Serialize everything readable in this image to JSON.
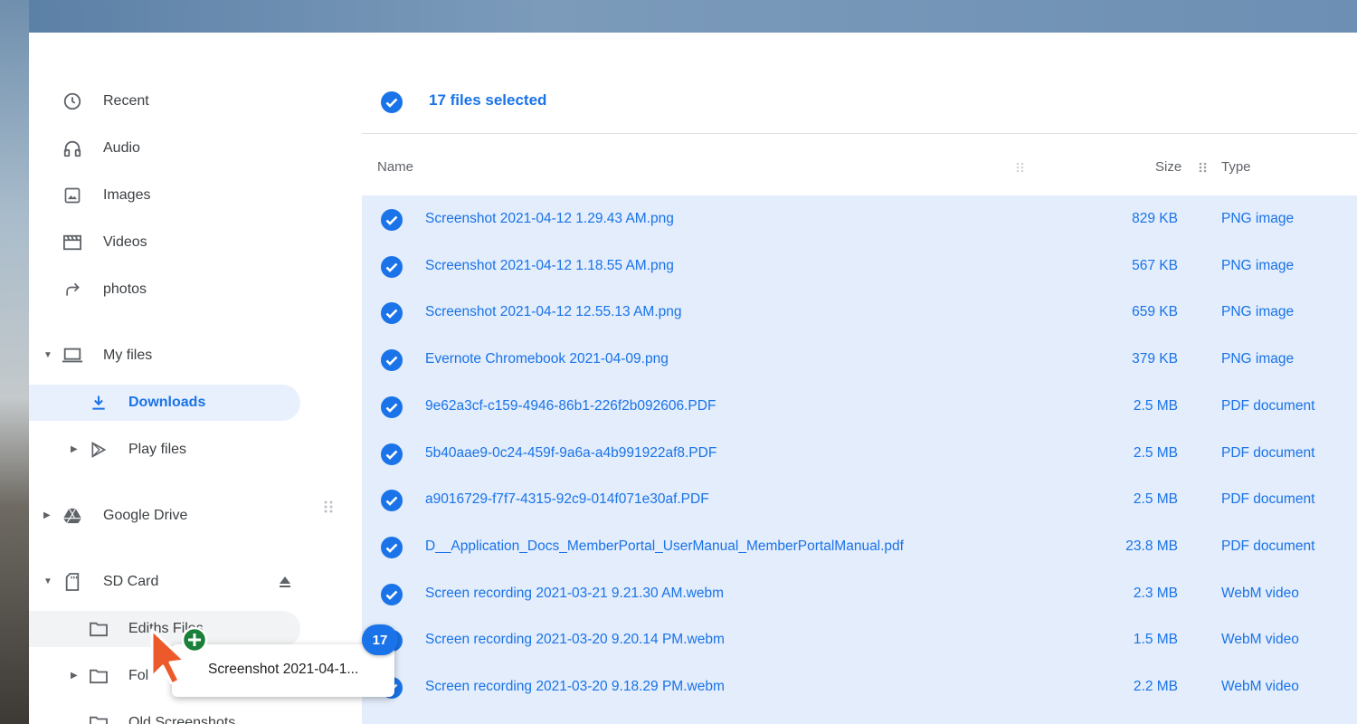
{
  "sidebar": {
    "recent": "Recent",
    "audio": "Audio",
    "images": "Images",
    "videos": "Videos",
    "photos": "photos",
    "my_files": "My files",
    "downloads": "Downloads",
    "play_files": "Play files",
    "google_drive": "Google Drive",
    "sd_card": "SD Card",
    "ediths_files": "Ediths Files",
    "folder": "Fol",
    "old_screenshots": "Old Screenshots"
  },
  "header": {
    "selection_text": "17 files selected"
  },
  "columns": {
    "name": "Name",
    "size": "Size",
    "type": "Type"
  },
  "files": [
    {
      "name": "Screenshot 2021-04-12 1.29.43 AM.png",
      "size": "829 KB",
      "type": "PNG image"
    },
    {
      "name": "Screenshot 2021-04-12 1.18.55 AM.png",
      "size": "567 KB",
      "type": "PNG image"
    },
    {
      "name": "Screenshot 2021-04-12 12.55.13 AM.png",
      "size": "659 KB",
      "type": "PNG image"
    },
    {
      "name": "Evernote Chromebook 2021-04-09.png",
      "size": "379 KB",
      "type": "PNG image"
    },
    {
      "name": "9e62a3cf-c159-4946-86b1-226f2b092606.PDF",
      "size": "2.5 MB",
      "type": "PDF document"
    },
    {
      "name": "5b40aae9-0c24-459f-9a6a-a4b991922af8.PDF",
      "size": "2.5 MB",
      "type": "PDF document"
    },
    {
      "name": "a9016729-f7f7-4315-92c9-014f071e30af.PDF",
      "size": "2.5 MB",
      "type": "PDF document"
    },
    {
      "name": "D__Application_Docs_MemberPortal_UserManual_MemberPortalManual.pdf",
      "size": "23.8 MB",
      "type": "PDF document"
    },
    {
      "name": "Screen recording 2021-03-21 9.21.30 AM.webm",
      "size": "2.3 MB",
      "type": "WebM video"
    },
    {
      "name": "Screen recording 2021-03-20 9.20.14 PM.webm",
      "size": "1.5 MB",
      "type": "WebM video"
    },
    {
      "name": "Screen recording 2021-03-20 9.18.29 PM.webm",
      "size": "2.2 MB",
      "type": "WebM video"
    }
  ],
  "drag": {
    "count": "17",
    "label": "Screenshot 2021-04-1..."
  },
  "colors": {
    "accent": "#1a73e8",
    "selected_row_bg": "#e3edfb",
    "active_nav_bg": "#e8f0fe",
    "add_badge": "#188038"
  }
}
